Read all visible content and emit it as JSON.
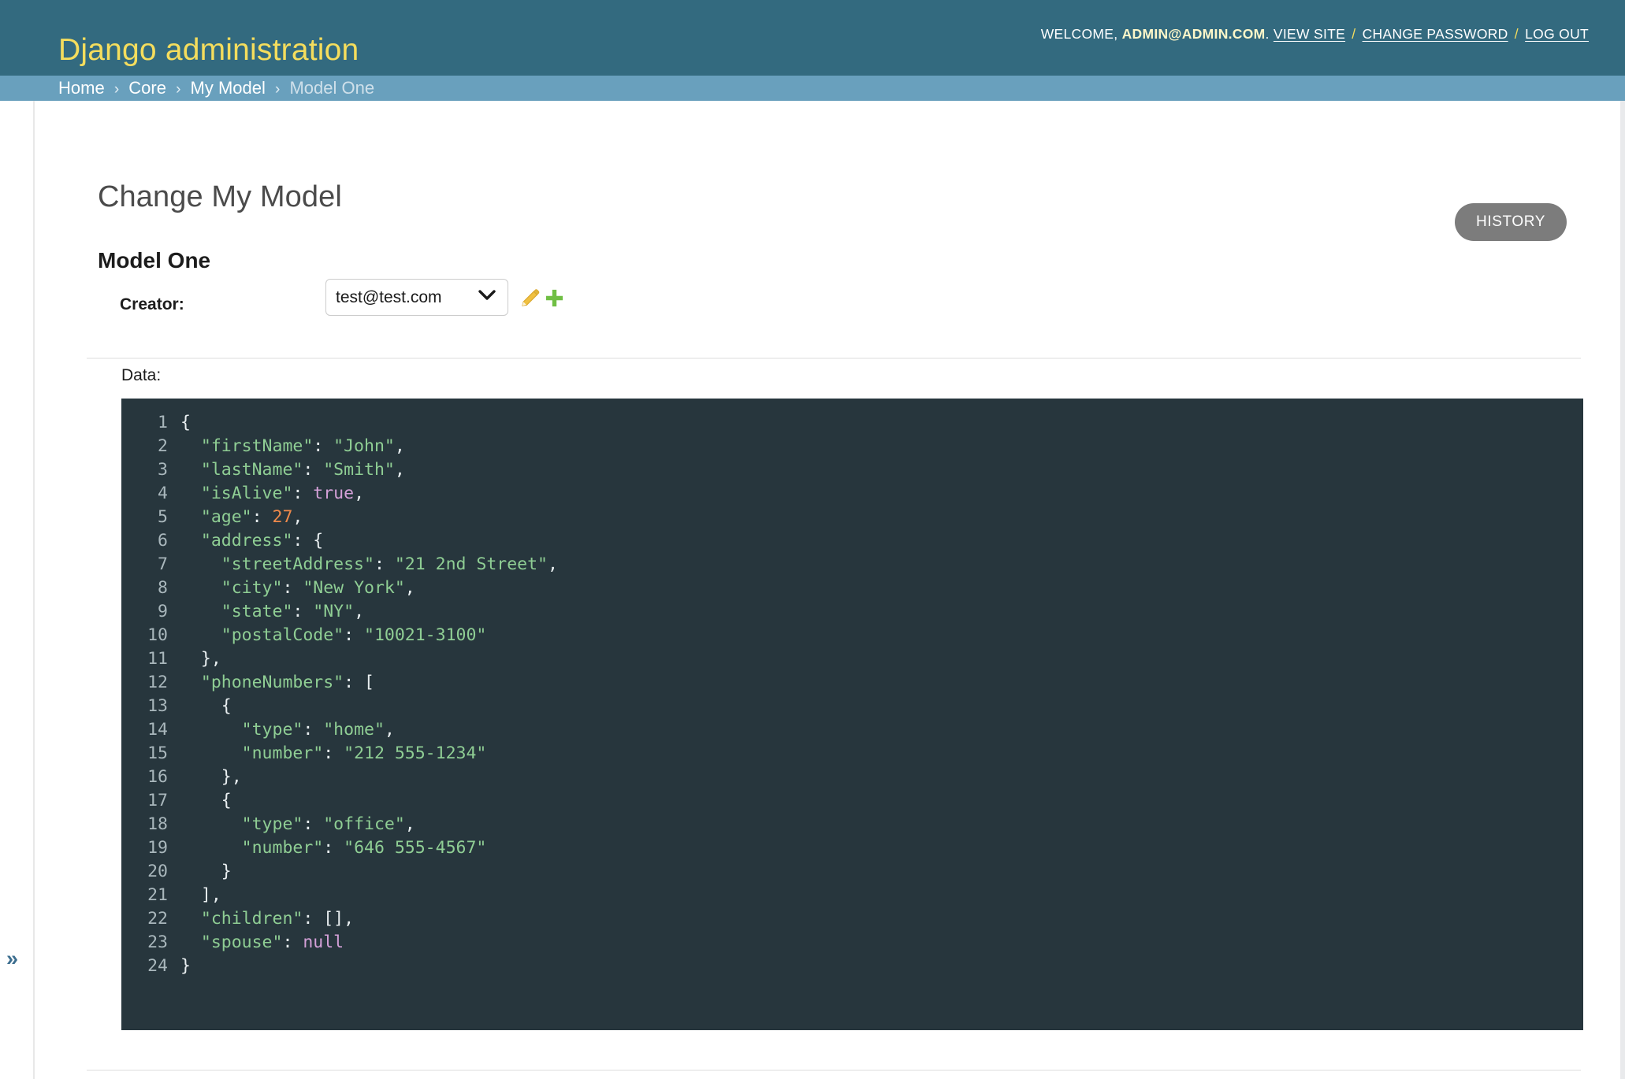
{
  "header": {
    "site_name": "Django administration",
    "welcome_prefix": "WELCOME,",
    "username": "ADMIN@ADMIN.COM",
    "username_suffix": ".",
    "links": {
      "view_site": "VIEW SITE",
      "change_password": "CHANGE PASSWORD",
      "log_out": "LOG OUT"
    },
    "separator": "/"
  },
  "breadcrumbs": {
    "items": [
      {
        "label": "Home",
        "current": false
      },
      {
        "label": "Core",
        "current": false
      },
      {
        "label": "My Model",
        "current": false
      },
      {
        "label": "Model One",
        "current": true
      }
    ],
    "separator": "›"
  },
  "content": {
    "page_title": "Change My Model",
    "history_button": "HISTORY",
    "module_title": "Model One"
  },
  "form": {
    "creator": {
      "label": "Creator:",
      "selected_value": "test@test.com",
      "options": [
        "test@test.com"
      ],
      "edit_icon": "pencil-icon",
      "add_icon": "plus-icon"
    },
    "data": {
      "label": "Data:",
      "line_count": 24,
      "raw": "{\n  \"firstName\": \"John\",\n  \"lastName\": \"Smith\",\n  \"isAlive\": true,\n  \"age\": 27,\n  \"address\": {\n    \"streetAddress\": \"21 2nd Street\",\n    \"city\": \"New York\",\n    \"state\": \"NY\",\n    \"postalCode\": \"10021-3100\"\n  },\n  \"phoneNumbers\": [\n    {\n      \"type\": \"home\",\n      \"number\": \"212 555-1234\"\n    },\n    {\n      \"type\": \"office\",\n      \"number\": \"646 555-4567\"\n    }\n  ],\n  \"children\": [],\n  \"spouse\": null\n}",
      "lines": [
        {
          "n": "1",
          "tokens": [
            {
              "t": "{",
              "c": "punc"
            }
          ]
        },
        {
          "n": "2",
          "tokens": [
            {
              "t": "  ",
              "c": "punc"
            },
            {
              "t": "\"firstName\"",
              "c": "key"
            },
            {
              "t": ": ",
              "c": "punc"
            },
            {
              "t": "\"John\"",
              "c": "str"
            },
            {
              "t": ",",
              "c": "punc"
            }
          ]
        },
        {
          "n": "3",
          "tokens": [
            {
              "t": "  ",
              "c": "punc"
            },
            {
              "t": "\"lastName\"",
              "c": "key"
            },
            {
              "t": ": ",
              "c": "punc"
            },
            {
              "t": "\"Smith\"",
              "c": "str"
            },
            {
              "t": ",",
              "c": "punc"
            }
          ]
        },
        {
          "n": "4",
          "tokens": [
            {
              "t": "  ",
              "c": "punc"
            },
            {
              "t": "\"isAlive\"",
              "c": "key"
            },
            {
              "t": ": ",
              "c": "punc"
            },
            {
              "t": "true",
              "c": "lit"
            },
            {
              "t": ",",
              "c": "punc"
            }
          ]
        },
        {
          "n": "5",
          "tokens": [
            {
              "t": "  ",
              "c": "punc"
            },
            {
              "t": "\"age\"",
              "c": "key"
            },
            {
              "t": ": ",
              "c": "punc"
            },
            {
              "t": "27",
              "c": "num"
            },
            {
              "t": ",",
              "c": "punc"
            }
          ]
        },
        {
          "n": "6",
          "tokens": [
            {
              "t": "  ",
              "c": "punc"
            },
            {
              "t": "\"address\"",
              "c": "key"
            },
            {
              "t": ": ",
              "c": "punc"
            },
            {
              "t": "{",
              "c": "punc"
            }
          ]
        },
        {
          "n": "7",
          "tokens": [
            {
              "t": "    ",
              "c": "punc"
            },
            {
              "t": "\"streetAddress\"",
              "c": "key"
            },
            {
              "t": ": ",
              "c": "punc"
            },
            {
              "t": "\"21 2nd Street\"",
              "c": "str"
            },
            {
              "t": ",",
              "c": "punc"
            }
          ]
        },
        {
          "n": "8",
          "tokens": [
            {
              "t": "    ",
              "c": "punc"
            },
            {
              "t": "\"city\"",
              "c": "key"
            },
            {
              "t": ": ",
              "c": "punc"
            },
            {
              "t": "\"New York\"",
              "c": "str"
            },
            {
              "t": ",",
              "c": "punc"
            }
          ]
        },
        {
          "n": "9",
          "tokens": [
            {
              "t": "    ",
              "c": "punc"
            },
            {
              "t": "\"state\"",
              "c": "key"
            },
            {
              "t": ": ",
              "c": "punc"
            },
            {
              "t": "\"NY\"",
              "c": "str"
            },
            {
              "t": ",",
              "c": "punc"
            }
          ]
        },
        {
          "n": "10",
          "tokens": [
            {
              "t": "    ",
              "c": "punc"
            },
            {
              "t": "\"postalCode\"",
              "c": "key"
            },
            {
              "t": ": ",
              "c": "punc"
            },
            {
              "t": "\"10021-3100\"",
              "c": "str"
            }
          ]
        },
        {
          "n": "11",
          "tokens": [
            {
              "t": "  ",
              "c": "punc"
            },
            {
              "t": "},",
              "c": "punc"
            }
          ]
        },
        {
          "n": "12",
          "tokens": [
            {
              "t": "  ",
              "c": "punc"
            },
            {
              "t": "\"phoneNumbers\"",
              "c": "key"
            },
            {
              "t": ": ",
              "c": "punc"
            },
            {
              "t": "[",
              "c": "punc"
            }
          ]
        },
        {
          "n": "13",
          "tokens": [
            {
              "t": "    ",
              "c": "punc"
            },
            {
              "t": "{",
              "c": "punc"
            }
          ]
        },
        {
          "n": "14",
          "tokens": [
            {
              "t": "      ",
              "c": "punc"
            },
            {
              "t": "\"type\"",
              "c": "key"
            },
            {
              "t": ": ",
              "c": "punc"
            },
            {
              "t": "\"home\"",
              "c": "str"
            },
            {
              "t": ",",
              "c": "punc"
            }
          ]
        },
        {
          "n": "15",
          "tokens": [
            {
              "t": "      ",
              "c": "punc"
            },
            {
              "t": "\"number\"",
              "c": "key"
            },
            {
              "t": ": ",
              "c": "punc"
            },
            {
              "t": "\"212 555-1234\"",
              "c": "str"
            }
          ]
        },
        {
          "n": "16",
          "tokens": [
            {
              "t": "    ",
              "c": "punc"
            },
            {
              "t": "},",
              "c": "punc"
            }
          ]
        },
        {
          "n": "17",
          "tokens": [
            {
              "t": "    ",
              "c": "punc"
            },
            {
              "t": "{",
              "c": "punc"
            }
          ]
        },
        {
          "n": "18",
          "tokens": [
            {
              "t": "      ",
              "c": "punc"
            },
            {
              "t": "\"type\"",
              "c": "key"
            },
            {
              "t": ": ",
              "c": "punc"
            },
            {
              "t": "\"office\"",
              "c": "str"
            },
            {
              "t": ",",
              "c": "punc"
            }
          ]
        },
        {
          "n": "19",
          "tokens": [
            {
              "t": "      ",
              "c": "punc"
            },
            {
              "t": "\"number\"",
              "c": "key"
            },
            {
              "t": ": ",
              "c": "punc"
            },
            {
              "t": "\"646 555-4567\"",
              "c": "str"
            }
          ]
        },
        {
          "n": "20",
          "tokens": [
            {
              "t": "    ",
              "c": "punc"
            },
            {
              "t": "}",
              "c": "punc"
            }
          ]
        },
        {
          "n": "21",
          "tokens": [
            {
              "t": "  ",
              "c": "punc"
            },
            {
              "t": "],",
              "c": "punc"
            }
          ]
        },
        {
          "n": "22",
          "tokens": [
            {
              "t": "  ",
              "c": "punc"
            },
            {
              "t": "\"children\"",
              "c": "key"
            },
            {
              "t": ": ",
              "c": "punc"
            },
            {
              "t": "[],",
              "c": "punc"
            }
          ]
        },
        {
          "n": "23",
          "tokens": [
            {
              "t": "  ",
              "c": "punc"
            },
            {
              "t": "\"spouse\"",
              "c": "key"
            },
            {
              "t": ": ",
              "c": "punc"
            },
            {
              "t": "null",
              "c": "lit"
            }
          ]
        },
        {
          "n": "24",
          "tokens": [
            {
              "t": "}",
              "c": "punc"
            }
          ]
        }
      ]
    }
  },
  "sidebar": {
    "toggle_icon": "»"
  },
  "colors": {
    "header_bg": "#336a7f",
    "breadcrumb_bg": "#69a0bd",
    "brand_text": "#f5dd5d",
    "editor_bg": "#27363d",
    "editor_key": "#8fce94",
    "editor_number": "#f08a4b",
    "editor_literal": "#d4a0d8",
    "history_button_bg": "#7c7c7c",
    "edit_icon": "#f0c040",
    "add_icon": "#70bf44"
  }
}
